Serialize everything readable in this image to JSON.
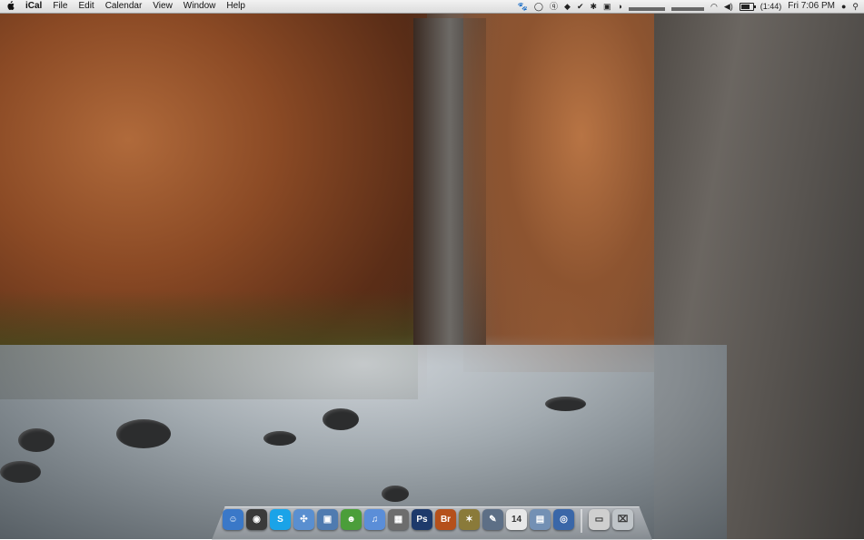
{
  "menubar": {
    "apple_icon": "apple-icon",
    "app_name": "iCal",
    "menus": [
      "File",
      "Edit",
      "Calendar",
      "View",
      "Window",
      "Help"
    ],
    "status": {
      "battery_time": "(1:44)",
      "clock": "Fri 7:06 PM"
    }
  },
  "dock": {
    "apps": [
      {
        "icon": "finder-icon",
        "color": "#3a78c8",
        "glyph": "☺"
      },
      {
        "icon": "dashboard-icon",
        "color": "#3a3a3a",
        "glyph": "◉"
      },
      {
        "icon": "skype-icon",
        "color": "#1aa3e8",
        "glyph": "S"
      },
      {
        "icon": "safari-icon",
        "color": "#5a8fd0",
        "glyph": "✣"
      },
      {
        "icon": "preview-icon",
        "color": "#4f7bb0",
        "glyph": "▣"
      },
      {
        "icon": "adium-icon",
        "color": "#4b9e3a",
        "glyph": "☻"
      },
      {
        "icon": "itunes-icon",
        "color": "#5b8ed8",
        "glyph": "♫"
      },
      {
        "icon": "iphoto-icon",
        "color": "#6d6d6d",
        "glyph": "▦"
      },
      {
        "icon": "photoshop-icon",
        "color": "#1e3a6b",
        "glyph": "Ps"
      },
      {
        "icon": "bridge-icon",
        "color": "#b5501b",
        "glyph": "Br"
      },
      {
        "icon": "starburst-icon",
        "color": "#8a7a3a",
        "glyph": "✶"
      },
      {
        "icon": "script-editor-icon",
        "color": "#5d6f86",
        "glyph": "✎"
      },
      {
        "icon": "ical-icon",
        "color": "#e8e8e8",
        "glyph": "14"
      },
      {
        "icon": "text-edit-icon",
        "color": "#7390b4",
        "glyph": "▤"
      },
      {
        "icon": "time-machine-icon",
        "color": "#3a67a8",
        "glyph": "◎"
      }
    ],
    "trailing": [
      {
        "icon": "documents-stack-icon",
        "color": "#cfcfcf",
        "glyph": "▭"
      },
      {
        "icon": "trash-icon",
        "color": "#bfc4c8",
        "glyph": "⌧"
      }
    ]
  }
}
